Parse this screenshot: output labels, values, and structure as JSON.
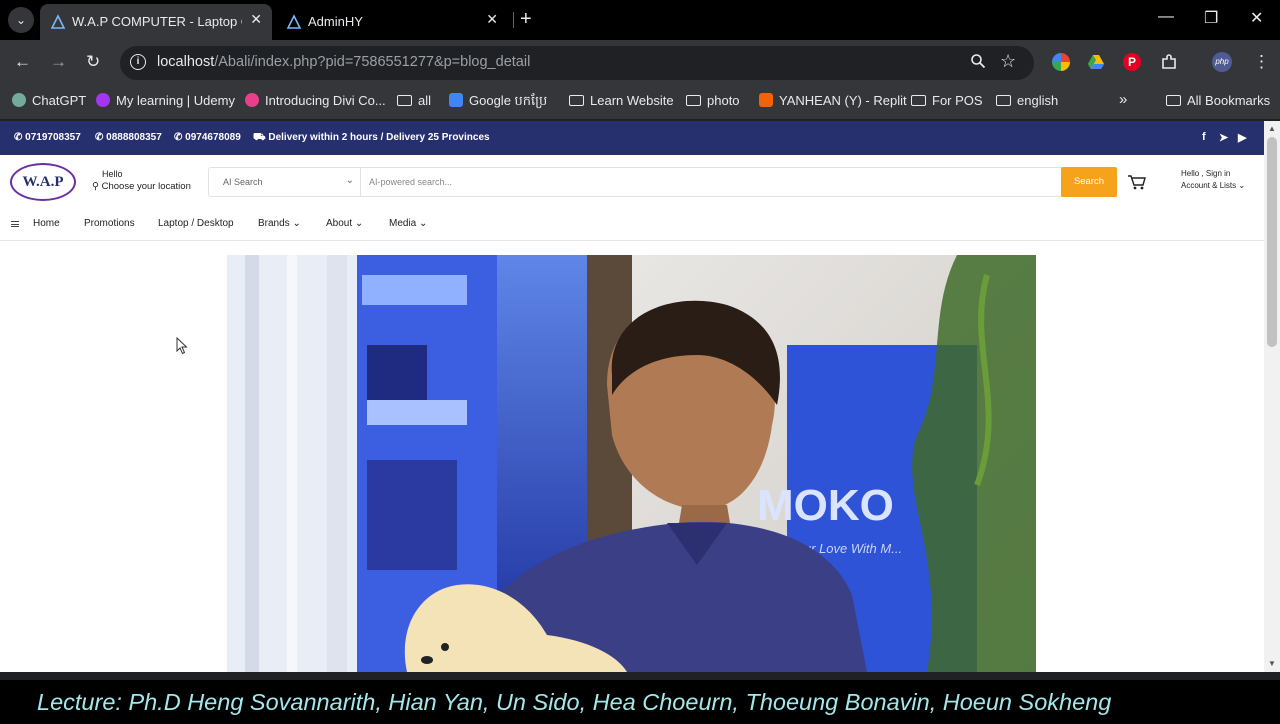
{
  "browser": {
    "tabs": [
      {
        "label": "W.A.P COMPUTER - Laptop Cam",
        "active": true
      },
      {
        "label": "AdminHY",
        "active": false
      }
    ],
    "url_host": "localhost",
    "url_path": "/Abali/index.php?pid=7586551277&p=blog_detail",
    "bookmarks": [
      {
        "label": "ChatGPT",
        "icon": "chatgpt-icon"
      },
      {
        "label": "My learning | Udemy",
        "icon": "udemy-icon"
      },
      {
        "label": "Introducing Divi Co...",
        "icon": "divi-icon"
      },
      {
        "label": "all",
        "icon": "folder-icon"
      },
      {
        "label": "Google បកប្រែ",
        "icon": "google-translate-icon"
      },
      {
        "label": "Learn Website",
        "icon": "folder-icon"
      },
      {
        "label": "photo",
        "icon": "folder-icon"
      },
      {
        "label": "YANHEAN (Y) - Replit",
        "icon": "replit-icon"
      },
      {
        "label": "For POS",
        "icon": "folder-icon"
      },
      {
        "label": "english",
        "icon": "folder-icon"
      }
    ],
    "all_bookmarks": "All Bookmarks",
    "more_bookmarks": "»"
  },
  "site": {
    "topbar": {
      "phone1": "0719708357",
      "phone2": "0888808357",
      "phone3": "0974678089",
      "delivery": "Delivery within 2 hours / Delivery 25 Provinces",
      "social": [
        "f",
        "➤",
        "▶"
      ]
    },
    "logo_text": "W.A.P",
    "location": {
      "hello": "Hello",
      "choose": "Choose your location"
    },
    "search": {
      "select_label": "AI Search",
      "placeholder": "AI-powered search...",
      "button": "Search"
    },
    "account": {
      "line1": "Hello , Sign in",
      "line2": "Account & Lists"
    },
    "nav": [
      "Home",
      "Promotions",
      "Laptop / Desktop",
      "Brands",
      "About",
      "Media"
    ]
  },
  "photo_text": {
    "sign": "MOKO",
    "tagline": "...ing Our Love With M..."
  },
  "caption": "Lecture: Ph.D Heng Sovannarith,   Hian Yan,  Un Sido, Hea Choeurn, Thoeung Bonavin, Hoeun Sokheng",
  "colors": {
    "topbar": "#27306e",
    "search_button": "#f6a21d",
    "caption_text": "#a4e7ea"
  }
}
